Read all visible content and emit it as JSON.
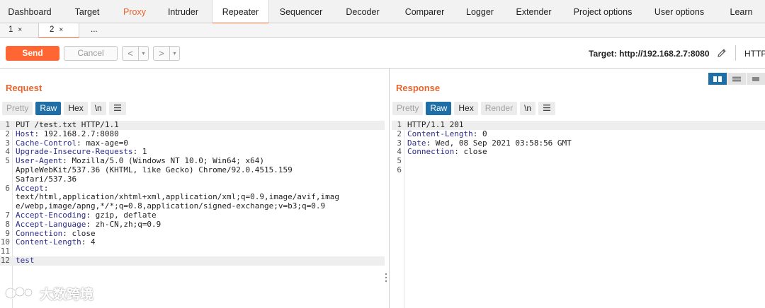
{
  "tool_tabs": [
    {
      "label": "Dashboard"
    },
    {
      "label": "Target"
    },
    {
      "label": "Proxy"
    },
    {
      "label": "Intruder"
    },
    {
      "label": "Repeater"
    },
    {
      "label": "Sequencer"
    },
    {
      "label": "Decoder"
    },
    {
      "label": "Comparer"
    },
    {
      "label": "Logger"
    },
    {
      "label": "Extender"
    },
    {
      "label": "Project options"
    },
    {
      "label": "User options"
    },
    {
      "label": "Learn"
    }
  ],
  "sub_tabs": [
    {
      "label": "1",
      "close": "×"
    },
    {
      "label": "2",
      "close": "×"
    },
    {
      "label": "..."
    }
  ],
  "toolbar": {
    "send_label": "Send",
    "cancel_label": "Cancel",
    "back_arrow": "<",
    "forward_arrow": ">",
    "dropdown": "▾",
    "target_text": "Target: http://192.168.2.7:8080",
    "http_label": "HTTP/"
  },
  "request": {
    "title": "Request",
    "views": [
      "Pretty",
      "Raw",
      "Hex",
      "\\n"
    ],
    "lines": [
      {
        "n": "1",
        "key": "",
        "text": "PUT /test.txt HTTP/1.1"
      },
      {
        "n": "2",
        "key": "Host",
        "text": ": 192.168.2.7:8080"
      },
      {
        "n": "3",
        "key": "Cache-Control",
        "text": ": max-age=0"
      },
      {
        "n": "4",
        "key": "Upgrade-Insecure-Requests",
        "text": ": 1"
      },
      {
        "n": "5",
        "key": "User-Agent",
        "text": ": Mozilla/5.0 (Windows NT 10.0; Win64; x64)"
      },
      {
        "n": "",
        "key": "",
        "text": "AppleWebKit/537.36 (KHTML, like Gecko) Chrome/92.0.4515.159"
      },
      {
        "n": "",
        "key": "",
        "text": "Safari/537.36"
      },
      {
        "n": "6",
        "key": "Accept",
        "text": ":"
      },
      {
        "n": "",
        "key": "",
        "text": "text/html,application/xhtml+xml,application/xml;q=0.9,image/avif,imag"
      },
      {
        "n": "",
        "key": "",
        "text": "e/webp,image/apng,*/*;q=0.8,application/signed-exchange;v=b3;q=0.9"
      },
      {
        "n": "7",
        "key": "Accept-Encoding",
        "text": ": gzip, deflate"
      },
      {
        "n": "8",
        "key": "Accept-Language",
        "text": ": zh-CN,zh;q=0.9"
      },
      {
        "n": "9",
        "key": "Connection",
        "text": ": close"
      },
      {
        "n": "10",
        "key": "Content-Length",
        "text": ": 4"
      },
      {
        "n": "11",
        "key": "",
        "text": ""
      },
      {
        "n": "12",
        "key": "test",
        "text": ""
      }
    ]
  },
  "response": {
    "title": "Response",
    "views": [
      "Pretty",
      "Raw",
      "Hex",
      "Render",
      "\\n"
    ],
    "lines": [
      {
        "n": "1",
        "key": "",
        "text": "HTTP/1.1 201"
      },
      {
        "n": "2",
        "key": "Content-Length",
        "text": ": 0"
      },
      {
        "n": "3",
        "key": "Date",
        "text": ": Wed, 08 Sep 2021 03:58:56 GMT"
      },
      {
        "n": "4",
        "key": "Connection",
        "text": ": close"
      },
      {
        "n": "5",
        "key": "",
        "text": ""
      },
      {
        "n": "6",
        "key": "",
        "text": ""
      }
    ]
  },
  "watermark": {
    "text": "大数跨境"
  },
  "colors": {
    "accent": "#ff6633",
    "selected": "#1f6fa6",
    "title": "#e8642e",
    "header_key": "#2c2c8c"
  }
}
